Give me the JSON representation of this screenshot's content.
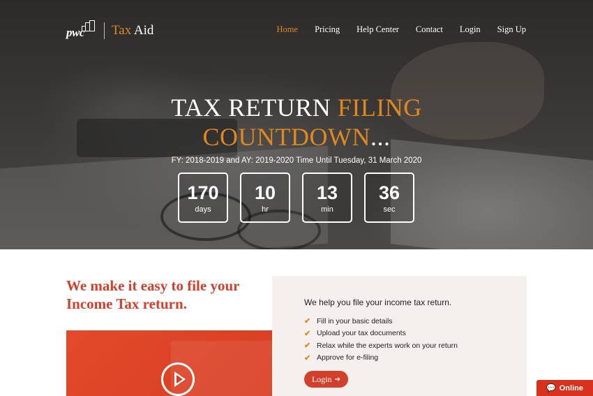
{
  "logo": {
    "mark": "pwc",
    "brand_a": "Tax",
    "brand_b": " Aid"
  },
  "nav": {
    "items": [
      {
        "label": "Home",
        "active": true
      },
      {
        "label": "Pricing"
      },
      {
        "label": "Help Center"
      },
      {
        "label": "Contact"
      },
      {
        "label": "Login"
      },
      {
        "label": "Sign Up"
      }
    ]
  },
  "hero": {
    "title_a": "TAX RETURN ",
    "title_b": "FILING",
    "title_c": "COUNTDOWN",
    "title_d": "...",
    "subtitle": "FY: 2018-2019 and AY: 2019-2020 Time Until Tuesday, 31 March 2020",
    "countdown": [
      {
        "value": "170",
        "unit": "days"
      },
      {
        "value": "10",
        "unit": "hr"
      },
      {
        "value": "13",
        "unit": "min"
      },
      {
        "value": "36",
        "unit": "sec"
      }
    ]
  },
  "features": {
    "headline_1": "We make it easy to file your",
    "headline_2": "Income Tax return.",
    "intro": "We help you file your income tax return.",
    "items": [
      "Fill in your basic details",
      "Upload your tax documents",
      "Relax while the experts work on your return",
      "Approve for e-filing"
    ],
    "login_label": "Login",
    "login_icon": "arrow-right-icon"
  },
  "chat": {
    "label": "Online",
    "icon": "chat-bubble-icon"
  },
  "colors": {
    "accent_orange": "#e0871f",
    "brand_red": "#d23f2a",
    "card_bg": "#f5efee"
  }
}
